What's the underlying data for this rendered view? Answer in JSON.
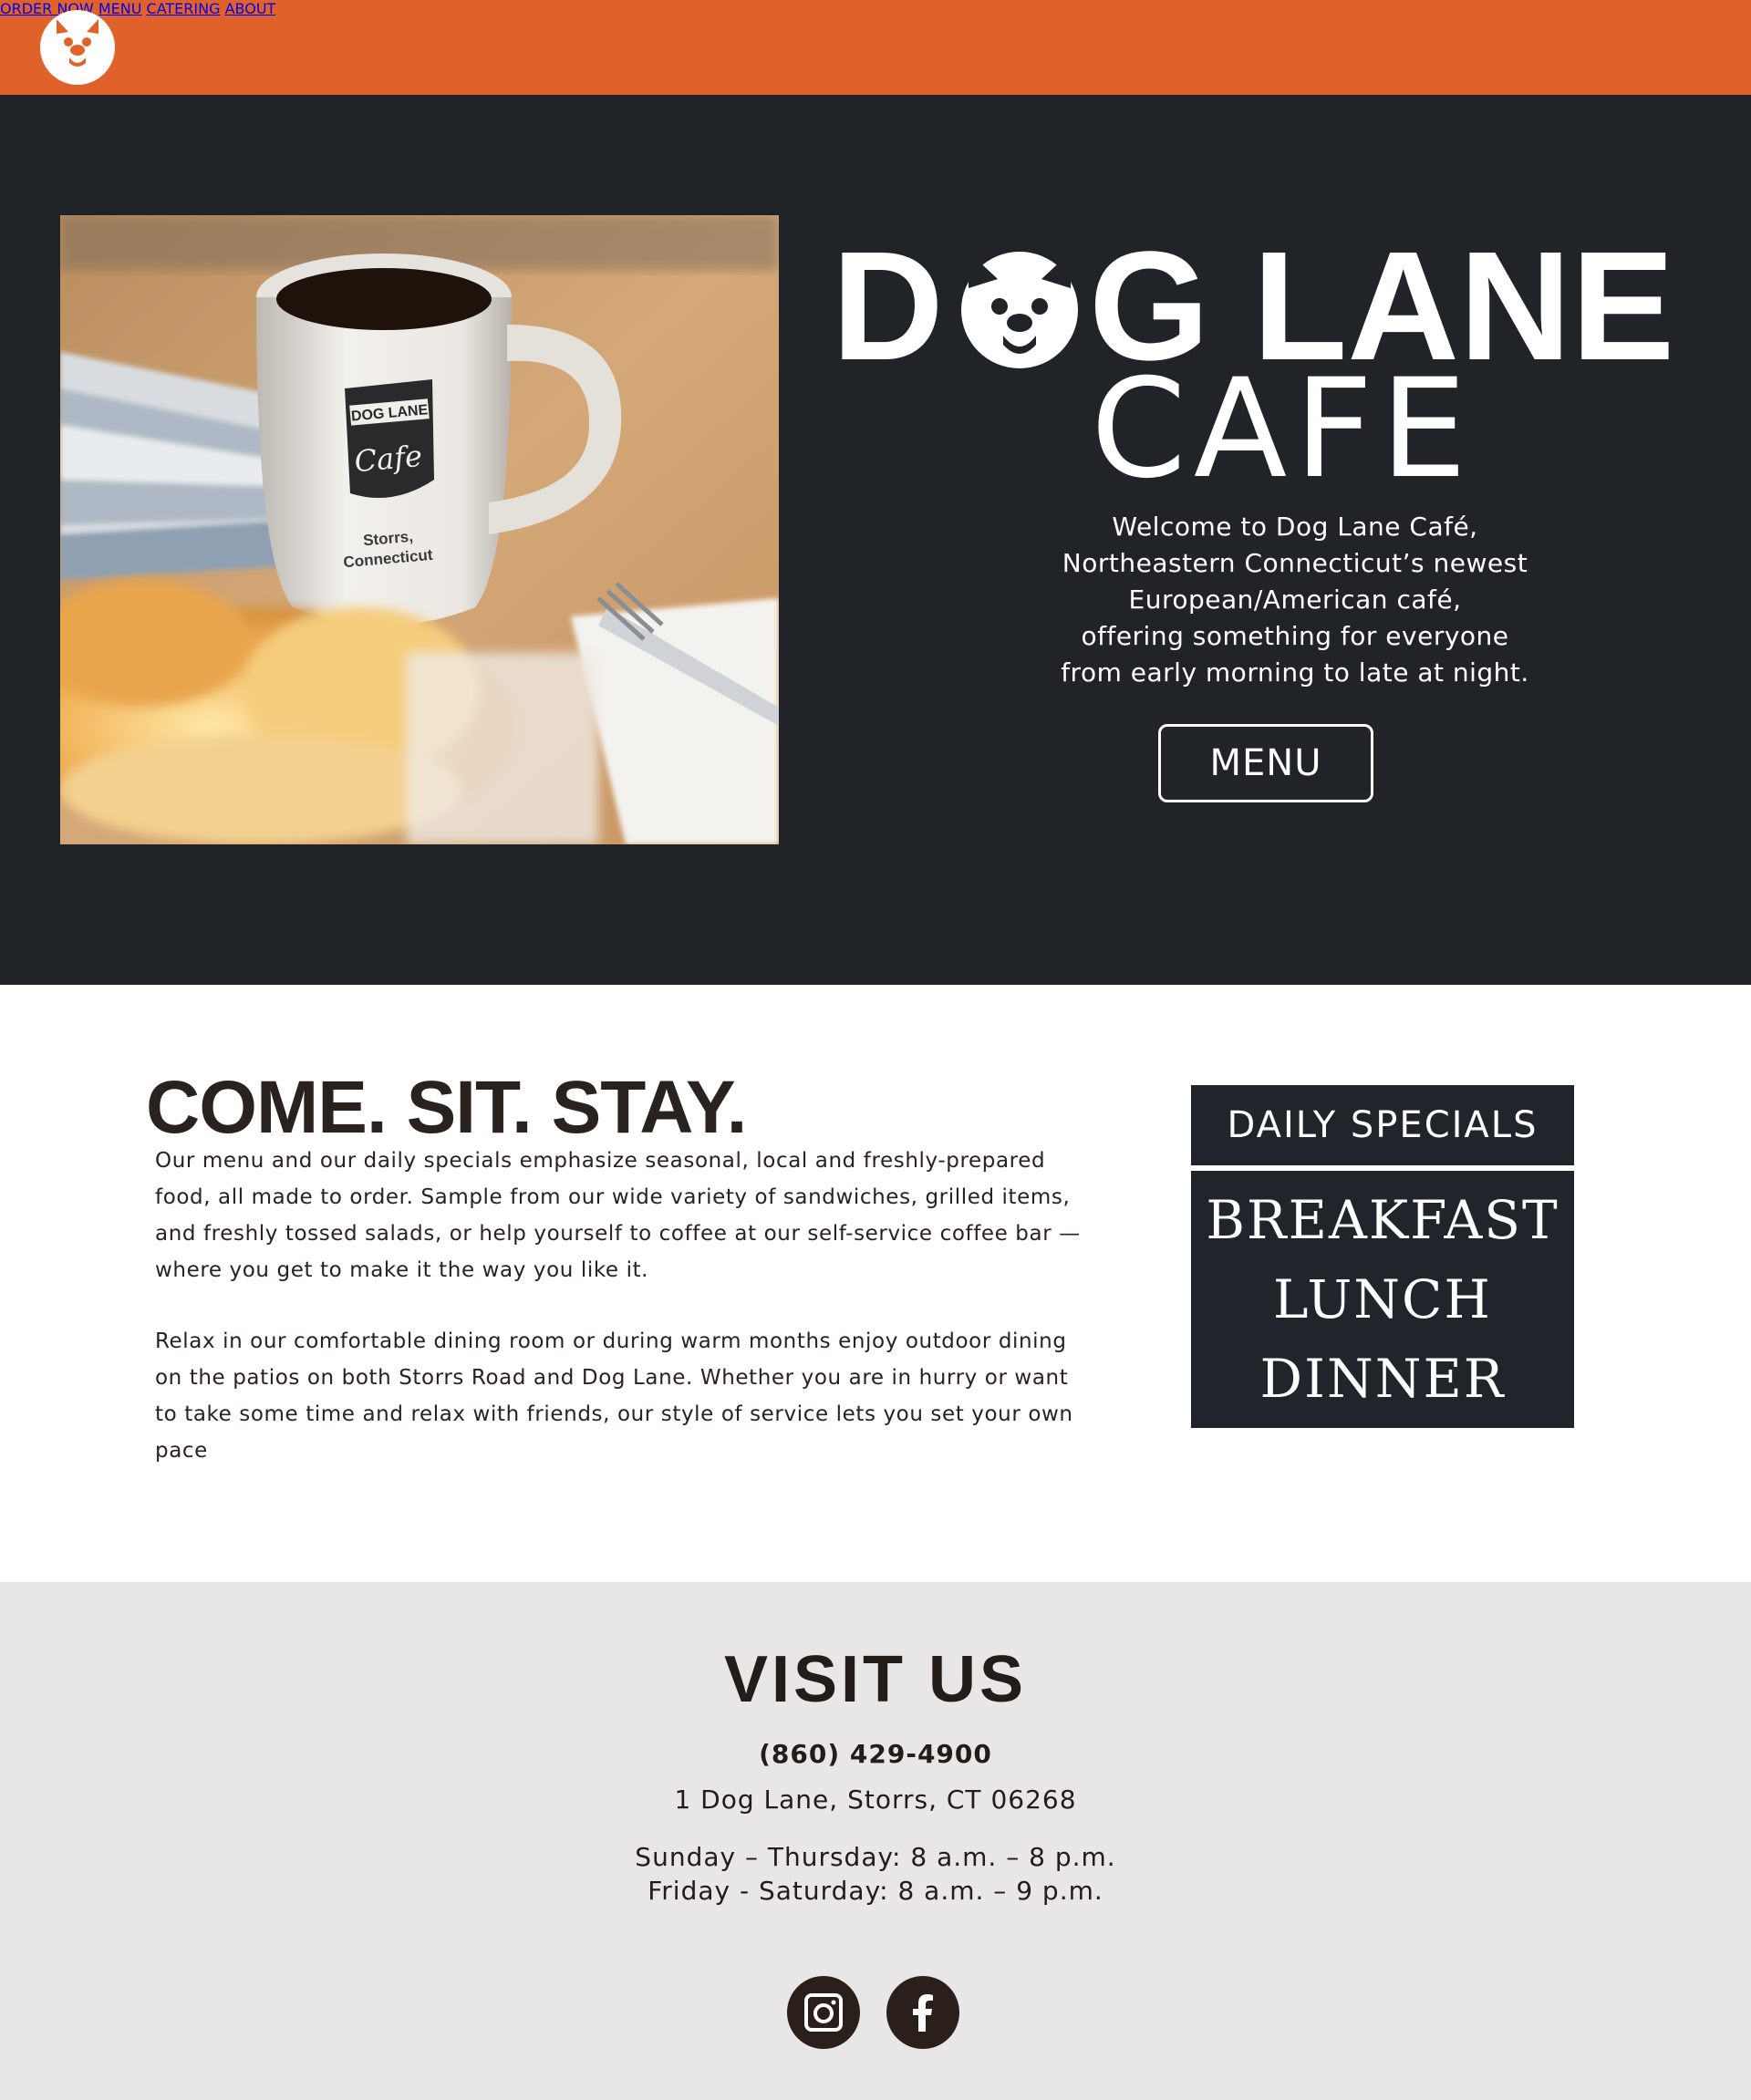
{
  "header": {
    "nav": [
      "ORDER NOW",
      "MENU",
      "CATERING",
      "ABOUT"
    ],
    "accent_color": "#e0622a",
    "logo_icon": "dog-face-logo"
  },
  "hero": {
    "brand_line1": "DOG LANE",
    "brand_line2": "CAFE",
    "welcome_lines": [
      "Welcome to Dog Lane Café,",
      "Northeastern Connecticut’s newest",
      "European/American café,",
      "offering something for everyone",
      "from early morning to late at night."
    ],
    "menu_button": "MENU",
    "photo": {
      "mug_label_top": "DOG LANE",
      "mug_label_script": "Cafe",
      "mug_location_1": "Storrs,",
      "mug_location_2": "Connecticut"
    },
    "background_color": "#202428"
  },
  "about": {
    "title": "COME. SIT. STAY.",
    "para1": "Our menu and our daily specials emphasize seasonal,  local and freshly-prepared food, all made to order. Sample from our wide variety of sandwiches, grilled items, and freshly tossed salads, or help yourself to coffee at our self-service coffee bar — where you get to make it the way you like it.",
    "para2": "Relax in our comfortable dining room or during warm months enjoy  outdoor dining on the patios on both Storrs Road and Dog Lane. Whether you are in hurry or want to take some time and  relax with friends, our style of service lets you set your own pace",
    "specials": {
      "heading": "DAILY SPECIALS",
      "items": [
        "BREAKFAST",
        "LUNCH",
        "DINNER"
      ]
    }
  },
  "visit": {
    "title": "VISIT US",
    "phone": "(860) 429-4900",
    "address": "1 Dog Lane, Storrs, CT 06268",
    "hours": [
      "Sunday – Thursday: 8 a.m. – 8 p.m.",
      "Friday - Saturday: 8 a.m. – 9 p.m."
    ],
    "social": [
      "instagram-icon",
      "facebook-icon"
    ]
  }
}
